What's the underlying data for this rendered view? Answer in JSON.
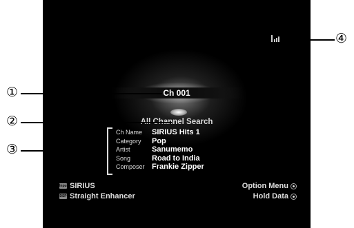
{
  "screen": {
    "channel": "Ch 001",
    "search_mode": "All Channel Search",
    "info": [
      {
        "label": "Ch Name",
        "value": "SIRIUS Hits 1"
      },
      {
        "label": "Category",
        "value": "Pop"
      },
      {
        "label": "Artist",
        "value": "Sanumemo"
      },
      {
        "label": "Song",
        "value": "Road to India"
      },
      {
        "label": "Composer",
        "value": "Frankie Zipper"
      }
    ],
    "input": {
      "tag": "Input",
      "value": "SIRIUS"
    },
    "dsp": {
      "tag": "DSP",
      "value": "Straight Enhancer"
    },
    "option_menu": "Option Menu",
    "hold_data": "Hold Data",
    "signal_icon": "antenna-signal-icon"
  },
  "callouts": [
    "①",
    "②",
    "③",
    "④"
  ]
}
